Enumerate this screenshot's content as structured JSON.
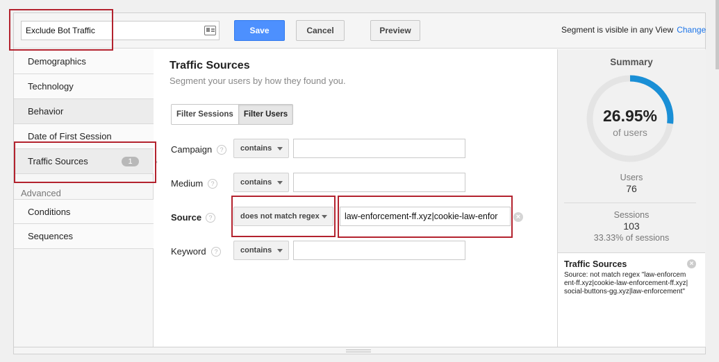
{
  "header": {
    "segment_name": "Exclude Bot Traffic",
    "save_label": "Save",
    "cancel_label": "Cancel",
    "preview_label": "Preview",
    "visibility_text": "Segment is visible in any View",
    "change_label": "Change"
  },
  "sidebar": {
    "items": [
      {
        "label": "Demographics"
      },
      {
        "label": "Technology"
      },
      {
        "label": "Behavior"
      },
      {
        "label": "Date of First Session"
      },
      {
        "label": "Traffic Sources",
        "badge": "1"
      }
    ],
    "advanced_heading": "Advanced",
    "advanced_items": [
      {
        "label": "Conditions"
      },
      {
        "label": "Sequences"
      }
    ]
  },
  "main": {
    "title": "Traffic Sources",
    "subtitle": "Segment your users by how they found you.",
    "toggle": {
      "sessions": "Filter Sessions",
      "users": "Filter Users"
    },
    "rows": [
      {
        "label": "Campaign",
        "operator": "contains",
        "value": ""
      },
      {
        "label": "Medium",
        "operator": "contains",
        "value": ""
      },
      {
        "label": "Source",
        "operator": "does not match regex",
        "value": "law-enforcement-ff.xyz|cookie-law-enfor"
      },
      {
        "label": "Keyword",
        "operator": "contains",
        "value": ""
      }
    ],
    "help_glyph": "?"
  },
  "summary": {
    "title": "Summary",
    "percent": "26.95%",
    "percent_label": "of users",
    "fraction": 0.2695,
    "users_label": "Users",
    "users_value": "76",
    "sessions_label": "Sessions",
    "sessions_value": "103",
    "sessions_pct": "33.33% of sessions",
    "filter_title": "Traffic Sources",
    "filter_desc": "Source: not match regex \"law-enforcement-ff.xyz|cookie-law-enforcement-ff.xyz|social-buttons-gg.xyz|law-enforcement\""
  },
  "colors": {
    "accent": "#4d90fe",
    "donut_fill": "#1a8fd6",
    "donut_track": "#e4e4e4",
    "highlight": "#b3222e"
  }
}
